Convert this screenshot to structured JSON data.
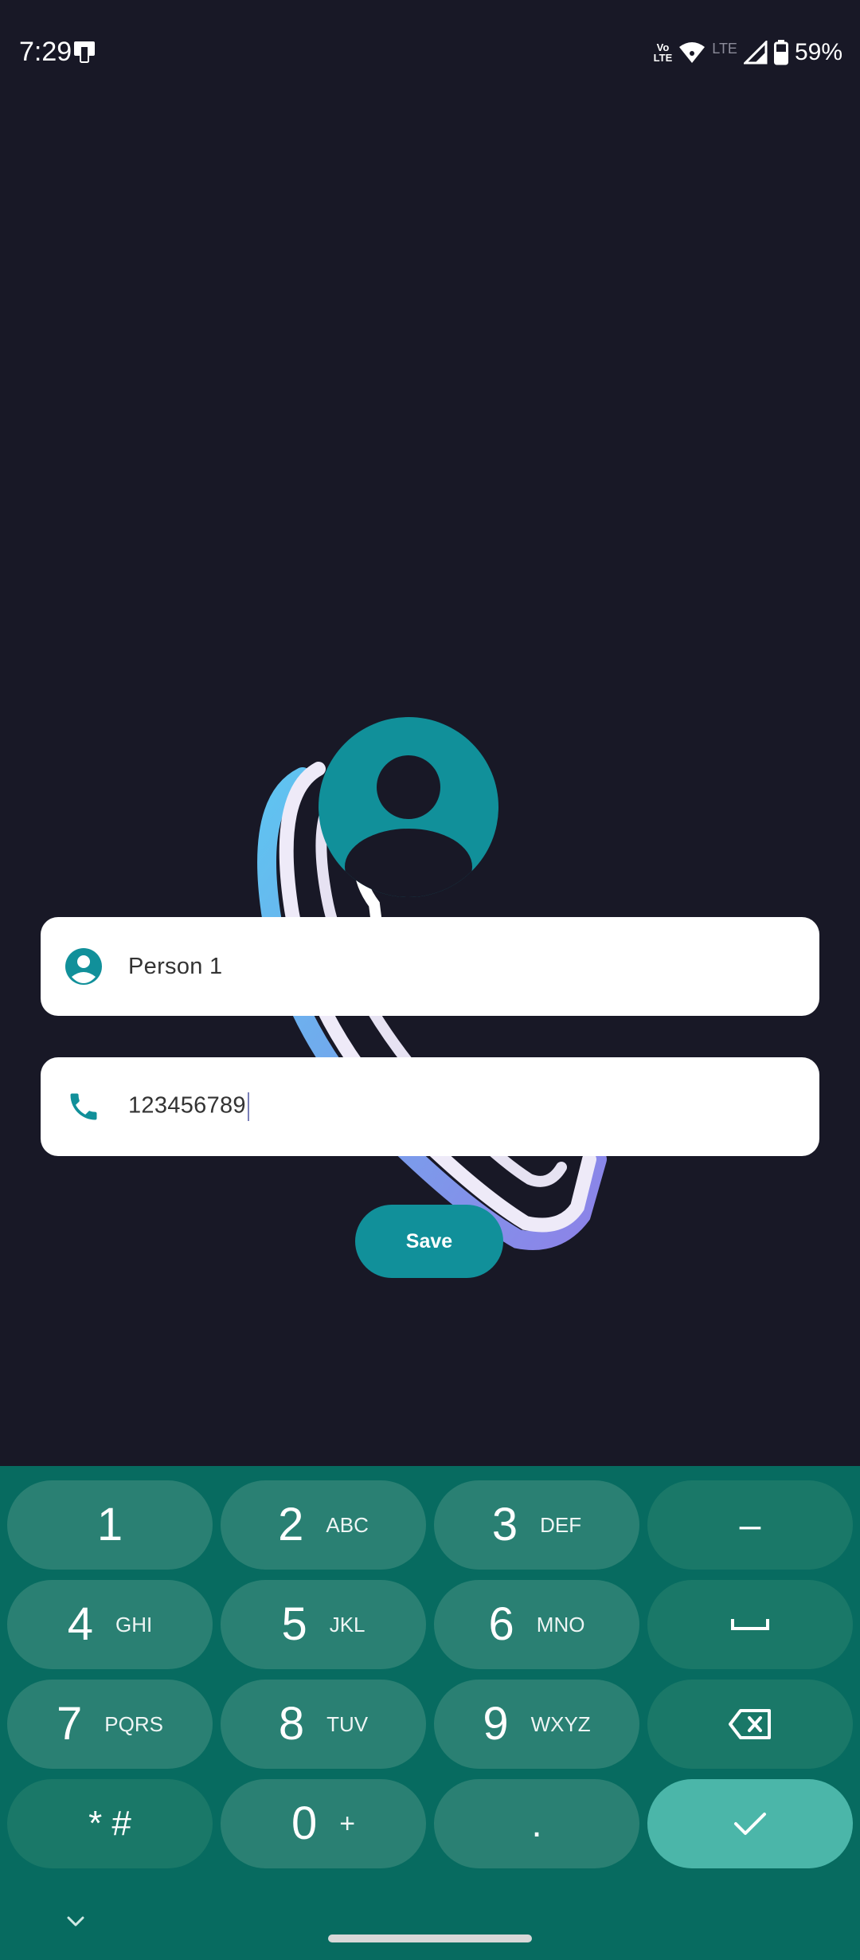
{
  "status_bar": {
    "time": "7:29",
    "volte_top": "Vo",
    "volte_bottom": "LTE",
    "lte": "LTE",
    "battery": "59%"
  },
  "form": {
    "name_value": "Person 1",
    "phone_value": "123456789",
    "save_label": "Save"
  },
  "keyboard": {
    "k1": "1",
    "k2": "2",
    "k2_letters": "ABC",
    "k3": "3",
    "k3_letters": "DEF",
    "k4": "4",
    "k4_letters": "GHI",
    "k5": "5",
    "k5_letters": "JKL",
    "k6": "6",
    "k6_letters": "MNO",
    "k7": "7",
    "k7_letters": "PQRS",
    "k8": "8",
    "k8_letters": "TUV",
    "k9": "9",
    "k9_letters": "WXYZ",
    "k0": "0",
    "k0_extra": "+",
    "star_hash": "* #",
    "dot": ".",
    "dash": "–"
  },
  "colors": {
    "background": "#181826",
    "accent": "#11909a",
    "keyboard_bg": "#076b60",
    "key_bg": "#2a8073",
    "enter_bg": "#4bb6a9"
  }
}
